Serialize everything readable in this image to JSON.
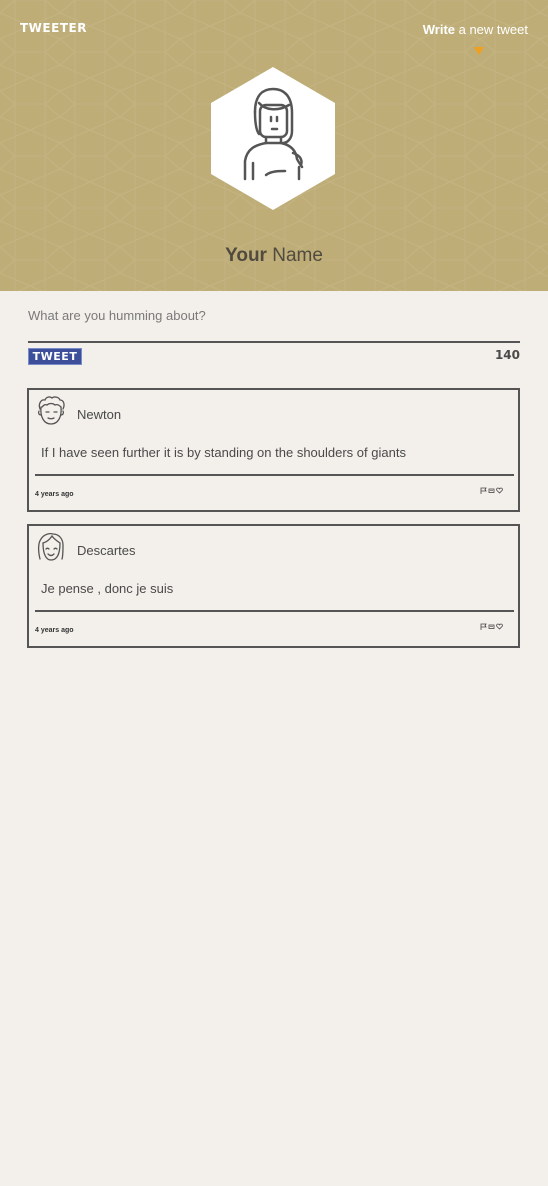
{
  "header": {
    "logo": "TWEETER",
    "write_link": {
      "strong": "Write",
      "rest": " a new tweet"
    },
    "profile": {
      "first": "Your",
      "last": " Name"
    },
    "accent_color": "#bead77",
    "arrow_color": "#f0a020"
  },
  "compose": {
    "placeholder": "What are you humming about?",
    "button_label": "TWEET",
    "char_count": "140",
    "button_color": "#3d4f9a"
  },
  "tweets": [
    {
      "user": "Newton",
      "text": "If I have seen further it is by standing on the shoulders of giants",
      "time": "4 years ago",
      "avatar_icon": "curly-hair-avatar-icon",
      "actions": [
        "flag-icon",
        "retweet-icon",
        "heart-icon"
      ]
    },
    {
      "user": "Descartes",
      "text": "Je pense , donc je suis",
      "time": "4 years ago",
      "avatar_icon": "bob-hair-avatar-icon",
      "actions": [
        "flag-icon",
        "retweet-icon",
        "heart-icon"
      ]
    }
  ]
}
